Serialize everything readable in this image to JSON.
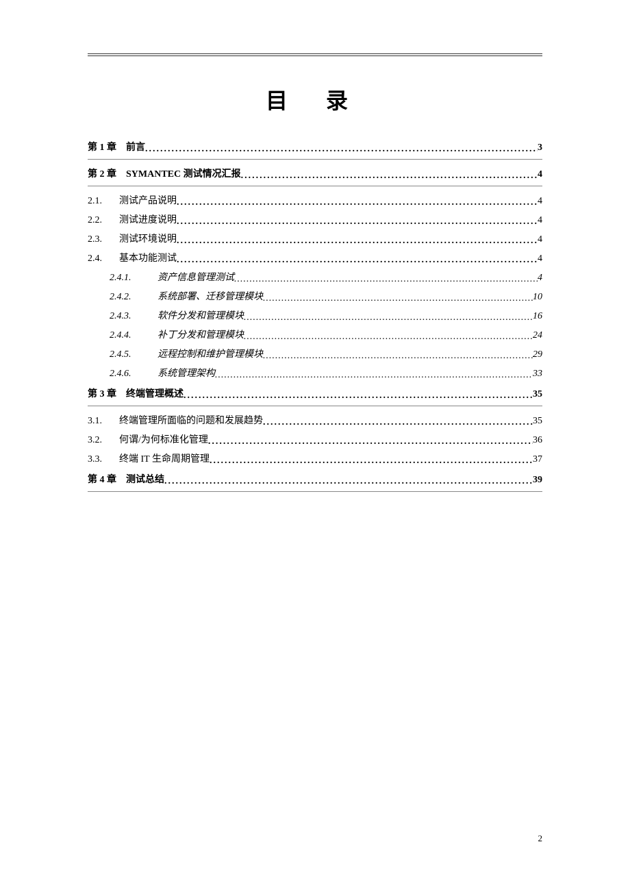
{
  "title": "目 录",
  "page_number": "2",
  "toc": [
    {
      "level": 0,
      "label": "第 1 章",
      "text": "前言",
      "page": "3"
    },
    {
      "level": 0,
      "label": "第 2 章",
      "text": "SYMANTEC 测试情况汇报",
      "page": "4"
    },
    {
      "level": 1,
      "label": "2.1.",
      "text": "测试产品说明",
      "page": "4"
    },
    {
      "level": 1,
      "label": "2.2.",
      "text": "测试进度说明",
      "page": "4"
    },
    {
      "level": 1,
      "label": "2.3.",
      "text": "测试环境说明",
      "page": "4"
    },
    {
      "level": 1,
      "label": "2.4.",
      "text": "基本功能测试",
      "page": "4"
    },
    {
      "level": 2,
      "label": "2.4.1.",
      "text": "资产信息管理测试",
      "page": "4"
    },
    {
      "level": 2,
      "label": "2.4.2.",
      "text": "系统部署、迁移管理模块",
      "page": "10"
    },
    {
      "level": 2,
      "label": "2.4.3.",
      "text": "软件分发和管理模块",
      "page": "16"
    },
    {
      "level": 2,
      "label": "2.4.4.",
      "text": "补丁分发和管理模块",
      "page": "24"
    },
    {
      "level": 2,
      "label": "2.4.5.",
      "text": "远程控制和维护管理模块",
      "page": "29"
    },
    {
      "level": 2,
      "label": "2.4.6.",
      "text": "系统管理架构",
      "page": "33"
    },
    {
      "level": 0,
      "label": "第 3 章",
      "text": "终端管理概述",
      "page": "35"
    },
    {
      "level": 1,
      "label": "3.1.",
      "text": "终端管理所面临的问题和发展趋势",
      "page": "35"
    },
    {
      "level": 1,
      "label": "3.2.",
      "text": "何谓/为何标准化管理",
      "page": "36"
    },
    {
      "level": 1,
      "label": "3.3.",
      "text": "终端 IT 生命周期管理",
      "page": "37"
    },
    {
      "level": 0,
      "label": "第 4 章",
      "text": "测试总结",
      "page": "39"
    }
  ]
}
